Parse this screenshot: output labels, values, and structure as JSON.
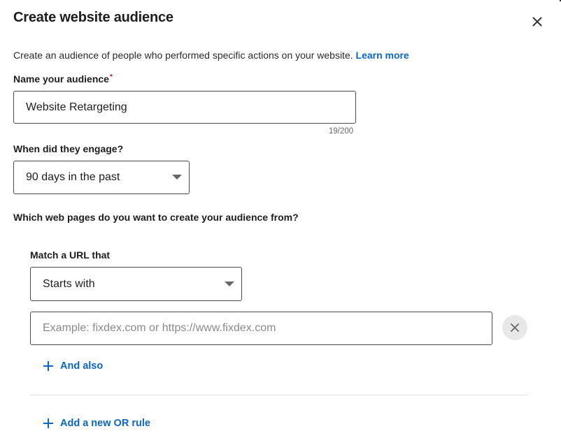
{
  "dialog": {
    "title": "Create website audience",
    "close_label": "Close",
    "description": "Create an audience of people who performed specific actions on your website.",
    "learn_more": "Learn more"
  },
  "audience_name": {
    "label": "Name your audience",
    "required_mark": "*",
    "value": "Website Retargeting",
    "counter": "19/200"
  },
  "engagement": {
    "label": "When did they engage?",
    "selected": "90 days in the past"
  },
  "web_pages": {
    "question": "Which web pages do you want to create your audience from?",
    "match_label": "Match a URL that",
    "match_selected": "Starts with",
    "url_value": "",
    "url_placeholder": "Example: fixdex.com or https://www.fixdex.com",
    "and_also": "And also",
    "add_or_rule": "Add a new OR rule"
  },
  "icons": {
    "close": "close-icon",
    "clear": "clear-icon",
    "caret": "chevron-down-icon",
    "plus": "plus-icon"
  },
  "colors": {
    "link": "#0a66c2",
    "required": "#cc1016",
    "border": "#4a4a4a"
  }
}
